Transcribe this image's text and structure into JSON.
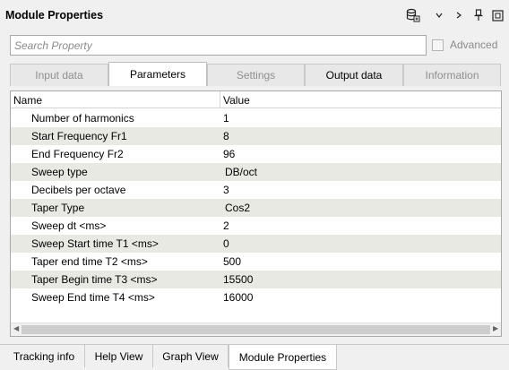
{
  "window": {
    "title": "Module Properties"
  },
  "toolbar": {
    "icons": [
      "database-icon",
      "chevron-down-icon",
      "chevron-right-icon",
      "pin-icon",
      "maximize-icon"
    ]
  },
  "search": {
    "placeholder": "Search Property",
    "value": ""
  },
  "advanced": {
    "label": "Advanced",
    "checked": false
  },
  "tabs": [
    {
      "label": "Input data",
      "state": "disabled"
    },
    {
      "label": "Parameters",
      "state": "active"
    },
    {
      "label": "Settings",
      "state": "disabled"
    },
    {
      "label": "Output data",
      "state": "enabled"
    },
    {
      "label": "Information",
      "state": "disabled"
    }
  ],
  "grid": {
    "columns": {
      "name": "Name",
      "value": "Value"
    },
    "rows": [
      {
        "name": "Number of harmonics",
        "value": "1"
      },
      {
        "name": "Start Frequency Fr1",
        "value": "8"
      },
      {
        "name": "End Frequency Fr2",
        "value": "96"
      },
      {
        "name": "Sweep type",
        "value": "DB/oct"
      },
      {
        "name": "Decibels per octave",
        "value": "3"
      },
      {
        "name": "Taper Type",
        "value": "Cos2"
      },
      {
        "name": "Sweep dt <ms>",
        "value": "2"
      },
      {
        "name": "Sweep Start time T1 <ms>",
        "value": "0"
      },
      {
        "name": "Taper end time T2 <ms>",
        "value": "500"
      },
      {
        "name": "Taper Begin time T3 <ms>",
        "value": "15500"
      },
      {
        "name": "Sweep End time T4 <ms>",
        "value": "16000"
      }
    ]
  },
  "bottom_tabs": [
    {
      "label": "Tracking info",
      "active": false
    },
    {
      "label": "Help View",
      "active": false
    },
    {
      "label": "Graph View",
      "active": false
    },
    {
      "label": "Module Properties",
      "active": true
    }
  ]
}
